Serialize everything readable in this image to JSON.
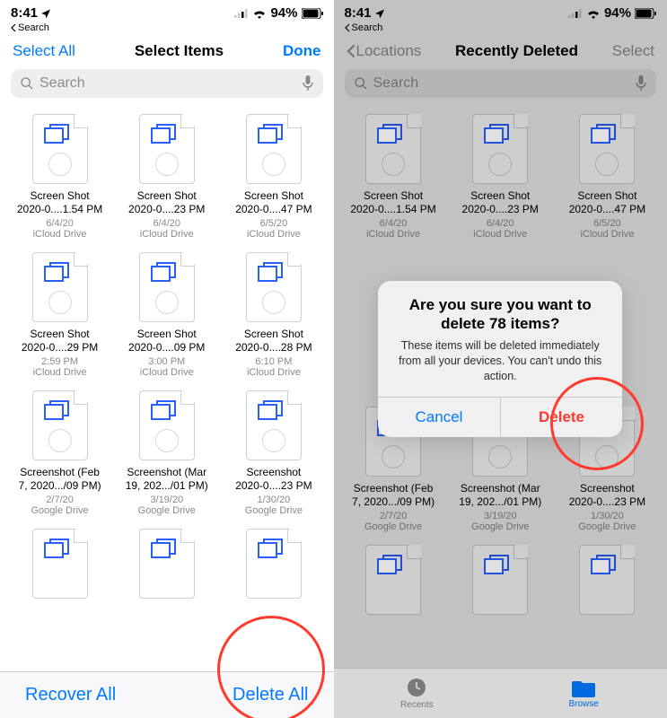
{
  "status": {
    "time": "8:41",
    "battery": "94%",
    "back_label": "Search"
  },
  "left": {
    "nav": {
      "left": "Select All",
      "title": "Select Items",
      "right": "Done"
    },
    "search_placeholder": "Search",
    "files": [
      {
        "name1": "Screen Shot",
        "name2": "2020-0....1.54 PM",
        "time": "6/4/20",
        "loc": "iCloud Drive"
      },
      {
        "name1": "Screen Shot",
        "name2": "2020-0....23 PM",
        "time": "6/4/20",
        "loc": "iCloud Drive"
      },
      {
        "name1": "Screen Shot",
        "name2": "2020-0....47 PM",
        "time": "6/5/20",
        "loc": "iCloud Drive"
      },
      {
        "name1": "Screen Shot",
        "name2": "2020-0....29 PM",
        "time": "2:59 PM",
        "loc": "iCloud Drive"
      },
      {
        "name1": "Screen Shot",
        "name2": "2020-0....09 PM",
        "time": "3:00 PM",
        "loc": "iCloud Drive"
      },
      {
        "name1": "Screen Shot",
        "name2": "2020-0....28 PM",
        "time": "6:10 PM",
        "loc": "iCloud Drive"
      },
      {
        "name1": "Screenshot (Feb",
        "name2": "7, 2020.../09 PM)",
        "time": "2/7/20",
        "loc": "Google Drive"
      },
      {
        "name1": "Screenshot (Mar",
        "name2": "19, 202.../01 PM)",
        "time": "3/19/20",
        "loc": "Google Drive"
      },
      {
        "name1": "Screenshot",
        "name2": "2020-0....23 PM",
        "time": "1/30/20",
        "loc": "Google Drive"
      }
    ],
    "toolbar": {
      "recover": "Recover All",
      "delete_all": "Delete All"
    }
  },
  "right": {
    "nav": {
      "left": "Locations",
      "title": "Recently Deleted",
      "right": "Select"
    },
    "search_placeholder": "Search",
    "files": [
      {
        "name1": "Screen Shot",
        "name2": "2020-0....1.54 PM",
        "time": "6/4/20",
        "loc": "iCloud Drive"
      },
      {
        "name1": "Screen Shot",
        "name2": "2020-0....23 PM",
        "time": "6/4/20",
        "loc": "iCloud Drive"
      },
      {
        "name1": "Screen Shot",
        "name2": "2020-0....47 PM",
        "time": "6/5/20",
        "loc": "iCloud Drive"
      },
      {
        "name1": "Screenshot (Feb",
        "name2": "7, 2020.../09 PM)",
        "time": "2/7/20",
        "loc": "Google Drive"
      },
      {
        "name1": "Screenshot (Mar",
        "name2": "19, 202.../01 PM)",
        "time": "3/19/20",
        "loc": "Google Drive"
      },
      {
        "name1": "Screenshot",
        "name2": "2020-0....23 PM",
        "time": "1/30/20",
        "loc": "Google Drive"
      }
    ],
    "alert": {
      "title": "Are you sure you want to delete 78 items?",
      "msg": "These items will be deleted immediately from all your devices. You can't undo this action.",
      "cancel": "Cancel",
      "delete": "Delete"
    },
    "tabs": {
      "recents": "Recents",
      "browse": "Browse"
    }
  }
}
